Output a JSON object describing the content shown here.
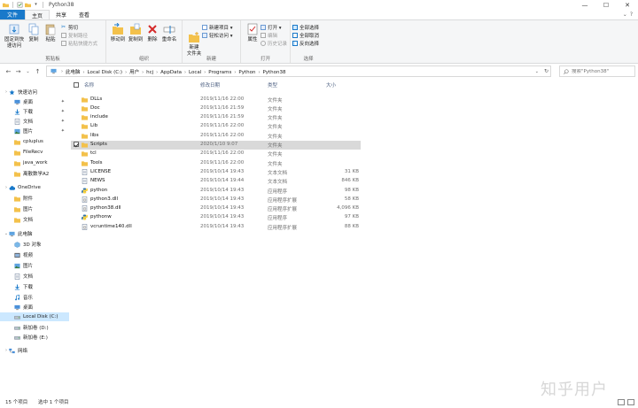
{
  "window": {
    "title": "Python38",
    "minimize": "—",
    "maximize": "☐",
    "close": "✕"
  },
  "tabs": {
    "file": "文件",
    "home": "主页",
    "share": "共享",
    "view": "查看"
  },
  "ribbon": {
    "clipboard": {
      "label": "剪贴板",
      "pin": "固定到快速访问",
      "copy": "复制",
      "paste": "粘贴",
      "cut": "剪切",
      "copy_path": "复制路径",
      "paste_shortcut": "粘贴快捷方式"
    },
    "organize": {
      "label": "组织",
      "move_to": "移动到",
      "copy_to": "复制到",
      "delete": "删除",
      "rename": "重命名"
    },
    "new": {
      "label": "新建",
      "new_folder": "新建\n文件夹",
      "new_item": "新建项目 ▾",
      "easy_access": "轻松访问 ▾"
    },
    "open": {
      "label": "打开",
      "properties": "属性",
      "open": "打开 ▾",
      "edit": "编辑",
      "history": "历史记录"
    },
    "select": {
      "label": "选择",
      "select_all": "全部选择",
      "select_none": "全部取消",
      "invert": "反向选择"
    }
  },
  "address": {
    "crumbs": [
      "此电脑",
      "Local Disk (C:)",
      "用户",
      "hcj",
      "AppData",
      "Local",
      "Programs",
      "Python",
      "Python38"
    ],
    "search_placeholder": "搜索\"Python38\""
  },
  "nav": {
    "items": [
      {
        "label": "快速访问",
        "icon": "star-icon",
        "pinned": false
      },
      {
        "label": "桌面",
        "icon": "desktop-icon",
        "pinned": true
      },
      {
        "label": "下载",
        "icon": "download-icon",
        "pinned": true
      },
      {
        "label": "文档",
        "icon": "document-icon",
        "pinned": true
      },
      {
        "label": "图片",
        "icon": "picture-icon",
        "pinned": true
      },
      {
        "label": "cpluplus",
        "icon": "folder-icon",
        "pinned": false
      },
      {
        "label": "FileRecv",
        "icon": "folder-icon",
        "pinned": false
      },
      {
        "label": "java_work",
        "icon": "folder-icon",
        "pinned": false
      },
      {
        "label": "离散数学A2",
        "icon": "folder-icon",
        "pinned": false
      },
      {
        "label": "OneDrive",
        "icon": "cloud-icon",
        "pinned": false
      },
      {
        "label": "附件",
        "icon": "folder-icon",
        "pinned": false
      },
      {
        "label": "图片",
        "icon": "folder-icon",
        "pinned": false
      },
      {
        "label": "文档",
        "icon": "folder-icon",
        "pinned": false
      },
      {
        "label": "此电脑",
        "icon": "computer-icon",
        "pinned": false
      },
      {
        "label": "3D 对象",
        "icon": "cube-icon",
        "pinned": false
      },
      {
        "label": "视频",
        "icon": "video-icon",
        "pinned": false
      },
      {
        "label": "图片",
        "icon": "picture-icon",
        "pinned": false
      },
      {
        "label": "文档",
        "icon": "document-icon",
        "pinned": false
      },
      {
        "label": "下载",
        "icon": "download-icon",
        "pinned": false
      },
      {
        "label": "音乐",
        "icon": "music-icon",
        "pinned": false
      },
      {
        "label": "桌面",
        "icon": "desktop-icon",
        "pinned": false
      },
      {
        "label": "Local Disk (C:)",
        "icon": "drive-icon",
        "pinned": false
      },
      {
        "label": "新加卷 (D:)",
        "icon": "drive-icon",
        "pinned": false
      },
      {
        "label": "新加卷 (E:)",
        "icon": "drive-icon",
        "pinned": false
      },
      {
        "label": "网络",
        "icon": "network-icon",
        "pinned": false
      }
    ]
  },
  "columns": {
    "name": "名称",
    "date": "修改日期",
    "type": "类型",
    "size": "大小"
  },
  "files": [
    {
      "name": "DLLs",
      "date": "2019/11/16 22:00",
      "type": "文件夹",
      "size": "",
      "icon": "folder"
    },
    {
      "name": "Doc",
      "date": "2019/11/16 21:59",
      "type": "文件夹",
      "size": "",
      "icon": "folder"
    },
    {
      "name": "include",
      "date": "2019/11/16 21:59",
      "type": "文件夹",
      "size": "",
      "icon": "folder"
    },
    {
      "name": "Lib",
      "date": "2019/11/16 22:00",
      "type": "文件夹",
      "size": "",
      "icon": "folder"
    },
    {
      "name": "libs",
      "date": "2019/11/16 22:00",
      "type": "文件夹",
      "size": "",
      "icon": "folder"
    },
    {
      "name": "Scripts",
      "date": "2020/1/10 9:07",
      "type": "文件夹",
      "size": "",
      "icon": "folder"
    },
    {
      "name": "tcl",
      "date": "2019/11/16 22:00",
      "type": "文件夹",
      "size": "",
      "icon": "folder"
    },
    {
      "name": "Tools",
      "date": "2019/11/16 22:00",
      "type": "文件夹",
      "size": "",
      "icon": "folder"
    },
    {
      "name": "LICENSE",
      "date": "2019/10/14 19:43",
      "type": "文本文档",
      "size": "31 KB",
      "icon": "text"
    },
    {
      "name": "NEWS",
      "date": "2019/10/14 19:44",
      "type": "文本文档",
      "size": "846 KB",
      "icon": "text"
    },
    {
      "name": "python",
      "date": "2019/10/14 19:43",
      "type": "应用程序",
      "size": "98 KB",
      "icon": "python"
    },
    {
      "name": "python3.dll",
      "date": "2019/10/14 19:43",
      "type": "应用程序扩展",
      "size": "58 KB",
      "icon": "dll"
    },
    {
      "name": "python38.dll",
      "date": "2019/10/14 19:43",
      "type": "应用程序扩展",
      "size": "4,096 KB",
      "icon": "dll"
    },
    {
      "name": "pythonw",
      "date": "2019/10/14 19:43",
      "type": "应用程序",
      "size": "97 KB",
      "icon": "python"
    },
    {
      "name": "vcruntime140.dll",
      "date": "2019/10/14 19:43",
      "type": "应用程序扩展",
      "size": "88 KB",
      "icon": "dll"
    }
  ],
  "status": {
    "count": "15 个项目",
    "selected": "选中 1 个项目"
  },
  "watermark": "知乎用户",
  "colors": {
    "accent": "#1979ca",
    "selection": "#cce8ff",
    "row_selected": "#d9d9d9",
    "folder": "#f3c14b"
  }
}
